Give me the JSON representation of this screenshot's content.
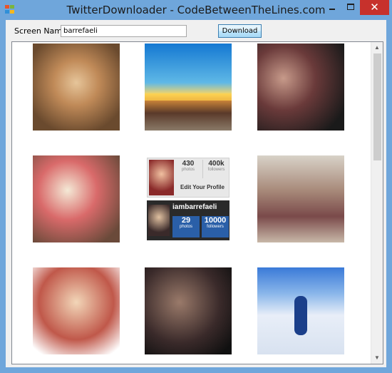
{
  "window": {
    "title": "TwitterDownloader - CodeBetweenTheLines.com",
    "close_glyph": "✕"
  },
  "form": {
    "screen_name_label": "Screen Name",
    "screen_name_value": "barrefaeli",
    "download_label": "Download"
  },
  "profile_tile": {
    "stat1_value": "430",
    "stat1_label": "photos",
    "stat2_value": "400k",
    "stat2_label": "followers",
    "edit_label": "Edit Your Profile",
    "handle": "iambarrefaeli",
    "box1_value": "29",
    "box1_label": "photos",
    "box2_value": "10000",
    "box2_label": "followers"
  },
  "scrollbar": {
    "up_glyph": "▲",
    "down_glyph": "▼"
  }
}
